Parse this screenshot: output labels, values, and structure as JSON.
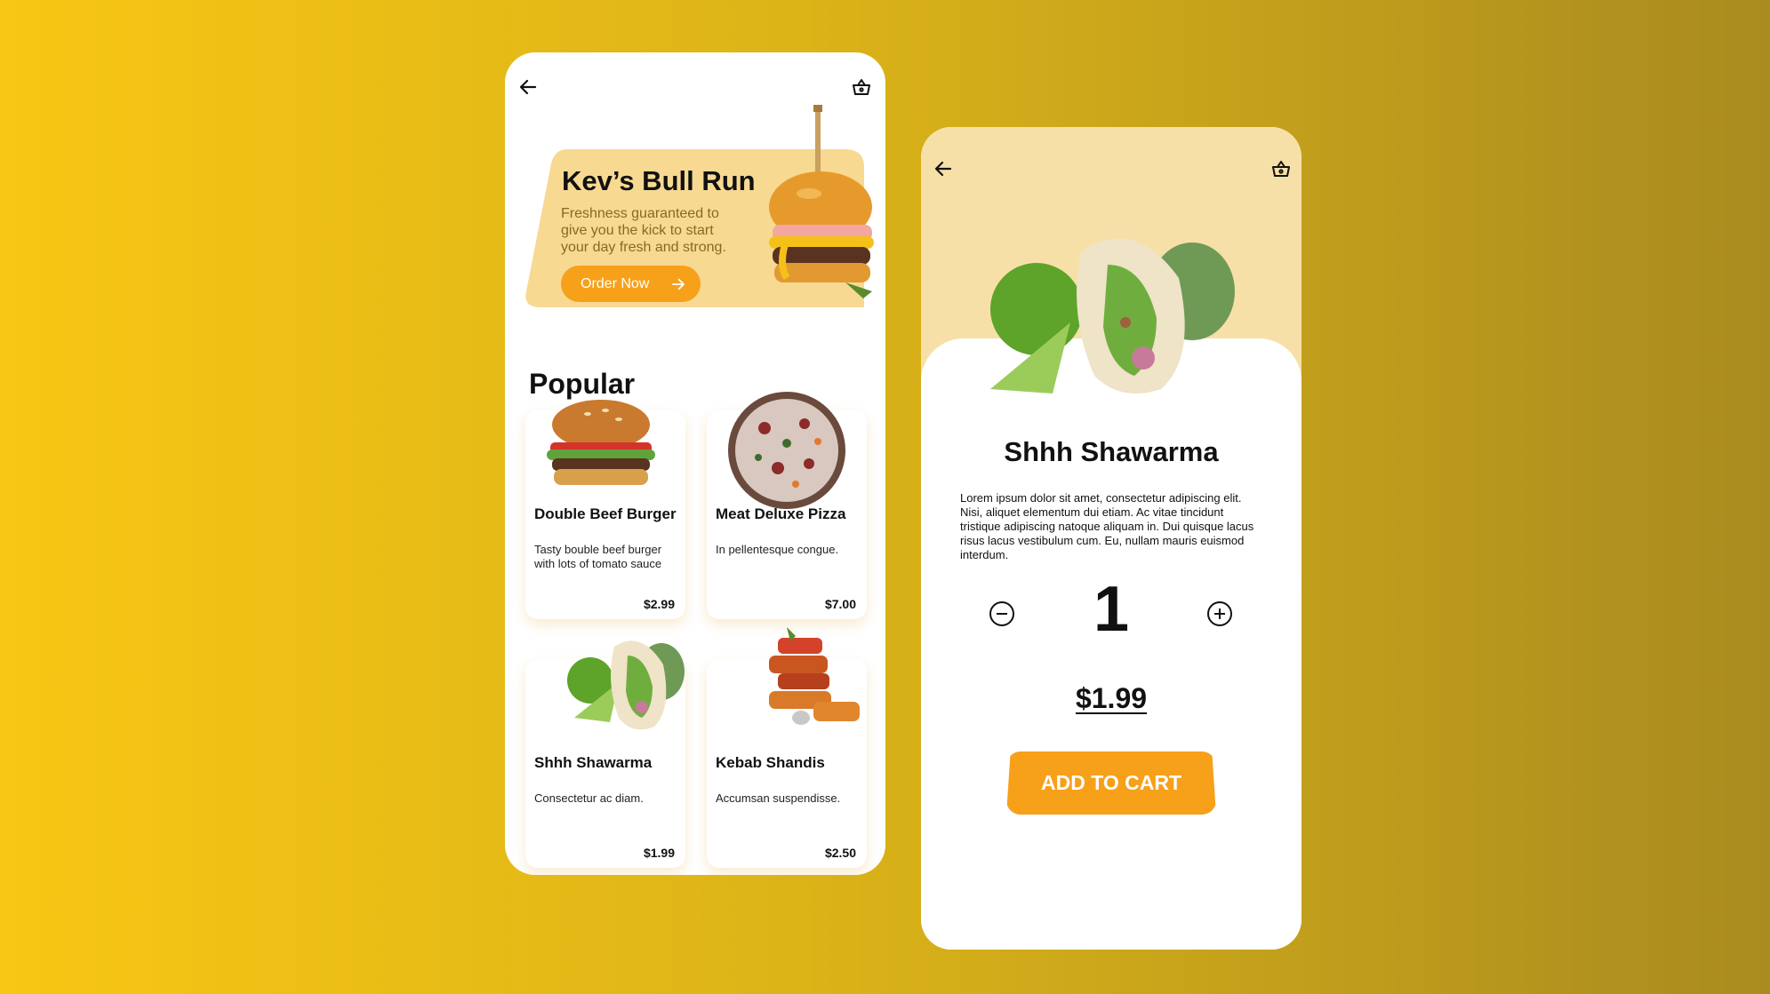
{
  "colors": {
    "accent": "#f7a01a",
    "hero_bg": "#f7d992",
    "detail_top_bg": "#f7e0a7",
    "hero_text": "#8a6a1c"
  },
  "icons": {
    "back": "back-arrow-icon",
    "basket": "basket-icon",
    "order_arrow": "arrow-right-icon",
    "minus": "minus-circle-icon",
    "plus": "plus-circle-icon"
  },
  "home": {
    "hero": {
      "title": "Kev’s Bull Run",
      "text": "Freshness guaranteed to give you the kick to start your day fresh and strong.",
      "button_label": "Order Now"
    },
    "popular_heading": "Popular",
    "items": [
      {
        "name": "Double Beef Burger",
        "desc": "Tasty bouble beef burger with lots of tomato sauce",
        "price": "$2.99"
      },
      {
        "name": "Meat Deluxe Pizza",
        "desc": "In pellentesque congue.",
        "price": "$7.00"
      },
      {
        "name": "Shhh Shawarma",
        "desc": "Consectetur ac diam.",
        "price": "$1.99"
      },
      {
        "name": "Kebab Shandis",
        "desc": "Accumsan suspendisse.",
        "price": "$2.50"
      }
    ]
  },
  "detail": {
    "title": "Shhh Shawarma",
    "description": "Lorem ipsum dolor sit amet, consectetur adipiscing elit. Nisi, aliquet elementum dui etiam. Ac vitae tincidunt tristique adipiscing natoque aliquam in. Dui quisque lacus risus lacus vestibulum cum. Eu, nullam mauris euismod interdum.",
    "quantity": "1",
    "price": "$1.99",
    "add_to_cart_label": "ADD TO CART"
  }
}
